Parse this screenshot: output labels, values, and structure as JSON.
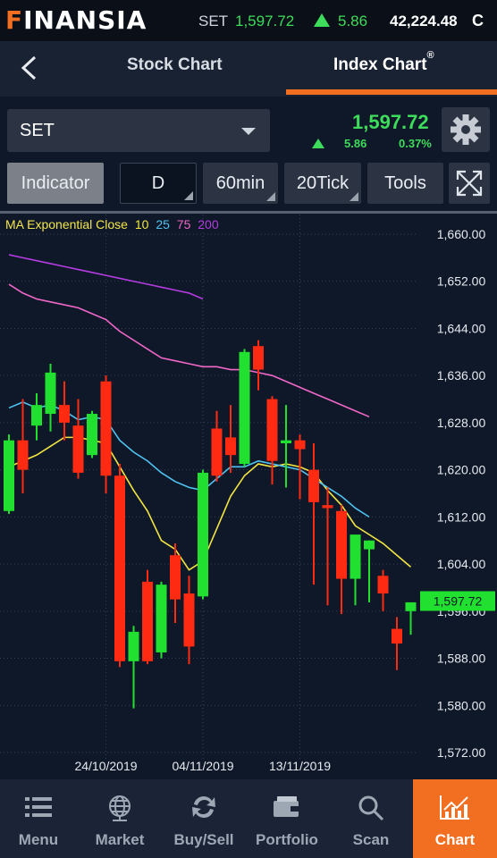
{
  "status": {
    "logo": "FINANSIA",
    "index_name": "SET",
    "index_value": "1,597.72",
    "index_change": "5.86",
    "volume": "42,224.48",
    "market_status": "C",
    "up_color": "#3ddc5a"
  },
  "header": {
    "back_icon": "chevron-left-icon",
    "tabs": [
      {
        "label": "Stock Chart",
        "active": false
      },
      {
        "label": "Index Chart",
        "active": true
      }
    ],
    "registered_mark": "®",
    "accent": "#f26f21"
  },
  "symbol": {
    "selected": "SET",
    "price": "1,597.72",
    "change": "5.86",
    "change_pct": "0.37%",
    "settings_icon": "gear-icon"
  },
  "toolbar": {
    "indicator": "Indicator",
    "period": "D",
    "interval_60": "60min",
    "tick_20": "20Tick",
    "tools": "Tools",
    "fullscreen_icon": "expand-icon"
  },
  "legend": {
    "label": "MA Exponential Close",
    "periods": [
      {
        "period": "10",
        "color": "#f2e542"
      },
      {
        "period": "25",
        "color": "#4fc3f0"
      },
      {
        "period": "75",
        "color": "#f067c8"
      },
      {
        "period": "200",
        "color": "#b43ce0"
      }
    ]
  },
  "chart_data": {
    "type": "candlestick",
    "ylim": [
      1568,
      1664
    ],
    "y_ticks": [
      "1,660.00",
      "1,652.00",
      "1,644.00",
      "1,636.00",
      "1,628.00",
      "1,620.00",
      "1,612.00",
      "1,604.00",
      "1,596.00",
      "1,588.00",
      "1,580.00",
      "1,572.00"
    ],
    "y_tick_values": [
      1660,
      1652,
      1644,
      1636,
      1628,
      1620,
      1612,
      1604,
      1596,
      1588,
      1580,
      1572
    ],
    "x_tick_labels": [
      {
        "label": "24/10/2019",
        "index": 7
      },
      {
        "label": "04/11/2019",
        "index": 14
      },
      {
        "label": "13/11/2019",
        "index": 21
      }
    ],
    "last_price_label": "1,597.72",
    "up_color": "#21e02f",
    "down_color": "#ff2a12",
    "candles": [
      {
        "o": 1613.0,
        "h": 1626.0,
        "l": 1612.5,
        "c": 1625.0
      },
      {
        "o": 1625.0,
        "h": 1632.0,
        "l": 1616.0,
        "c": 1620.0
      },
      {
        "o": 1627.5,
        "h": 1633.0,
        "l": 1625.0,
        "c": 1631.0
      },
      {
        "o": 1629.5,
        "h": 1638.0,
        "l": 1626.5,
        "c": 1636.5
      },
      {
        "o": 1631.0,
        "h": 1635.0,
        "l": 1625.0,
        "c": 1628.0
      },
      {
        "o": 1627.5,
        "h": 1632.0,
        "l": 1618.5,
        "c": 1619.5
      },
      {
        "o": 1622.5,
        "h": 1630.0,
        "l": 1622.0,
        "c": 1629.5
      },
      {
        "o": 1635.0,
        "h": 1636.0,
        "l": 1616.0,
        "c": 1619.0
      },
      {
        "o": 1619.0,
        "h": 1621.0,
        "l": 1586.5,
        "c": 1587.5
      },
      {
        "o": 1587.5,
        "h": 1593.5,
        "l": 1579.5,
        "c": 1592.5
      },
      {
        "o": 1601.0,
        "h": 1603.0,
        "l": 1587.0,
        "c": 1587.5
      },
      {
        "o": 1589.0,
        "h": 1601.0,
        "l": 1588.0,
        "c": 1600.5
      },
      {
        "o": 1605.5,
        "h": 1607.5,
        "l": 1594.0,
        "c": 1598.0
      },
      {
        "o": 1599.0,
        "h": 1602.0,
        "l": 1587.0,
        "c": 1590.0
      },
      {
        "o": 1598.5,
        "h": 1620.0,
        "l": 1598.0,
        "c": 1619.5
      },
      {
        "o": 1627.0,
        "h": 1630.0,
        "l": 1618.0,
        "c": 1619.0
      },
      {
        "o": 1625.5,
        "h": 1631.0,
        "l": 1619.5,
        "c": 1622.5
      },
      {
        "o": 1621.0,
        "h": 1640.5,
        "l": 1620.5,
        "c": 1640.0
      },
      {
        "o": 1641.0,
        "h": 1642.0,
        "l": 1633.5,
        "c": 1637.0
      },
      {
        "o": 1632.0,
        "h": 1632.5,
        "l": 1617.5,
        "c": 1621.5
      },
      {
        "o": 1624.5,
        "h": 1631.0,
        "l": 1617.0,
        "c": 1625.0
      },
      {
        "o": 1625.0,
        "h": 1626.0,
        "l": 1615.0,
        "c": 1623.5
      },
      {
        "o": 1620.0,
        "h": 1624.5,
        "l": 1600.5,
        "c": 1614.5
      },
      {
        "o": 1614.0,
        "h": 1617.0,
        "l": 1597.0,
        "c": 1613.5
      },
      {
        "o": 1613.0,
        "h": 1614.0,
        "l": 1595.5,
        "c": 1601.5
      },
      {
        "o": 1601.5,
        "h": 1609.0,
        "l": 1597.0,
        "c": 1609.0
      },
      {
        "o": 1606.5,
        "h": 1608.0,
        "l": 1597.5,
        "c": 1608.0
      },
      {
        "o": 1602.0,
        "h": 1603.0,
        "l": 1596.0,
        "c": 1599.0
      },
      {
        "o": 1593.0,
        "h": 1595.0,
        "l": 1586.0,
        "c": 1590.5
      },
      {
        "o": 1596.0,
        "h": 1597.5,
        "l": 1592.0,
        "c": 1597.5
      }
    ],
    "ma": [
      {
        "period": 10,
        "color": "#f2e542",
        "values": [
          1620.5,
          1621.5,
          1622.5,
          1624.0,
          1625.5,
          1625.5,
          1625.0,
          1624.5,
          1620.5,
          1616.5,
          1613.0,
          1608.0,
          1606.5,
          1603.0,
          1604.5,
          1610.0,
          1615.5,
          1619.0,
          1621.0,
          1620.5,
          1621.0,
          1620.5,
          1619.5,
          1616.5,
          1614.0,
          1610.5,
          1609.0,
          1607.5,
          1605.5,
          1603.5
        ]
      },
      {
        "period": 25,
        "color": "#4fc3f0",
        "values": [
          1630.5,
          1631.5,
          1630.5,
          1631.0,
          1630.0,
          1628.5,
          1629.0,
          1628.5,
          1625.0,
          1623.0,
          1621.5,
          1619.5,
          1618.0,
          1617.0,
          1616.5,
          1618.5,
          1620.5,
          1620.5,
          1621.5,
          1621.0,
          1620.5,
          1620.0,
          1618.5,
          1617.0,
          1615.5,
          1613.5,
          1612.0
        ]
      },
      {
        "period": 75,
        "color": "#f067c8",
        "values": [
          1651.5,
          1650.0,
          1649.0,
          1648.5,
          1648.0,
          1647.5,
          1646.5,
          1645.5,
          1643.5,
          1642.0,
          1640.5,
          1639.0,
          1638.5,
          1638.0,
          1637.5,
          1637.5,
          1637.0,
          1637.0,
          1636.5,
          1636.0,
          1635.0,
          1634.0,
          1633.0,
          1632.0,
          1631.0,
          1630.0,
          1629.0
        ]
      },
      {
        "period": 200,
        "color": "#b43ce0",
        "values": [
          1656.5,
          1656.0,
          1655.5,
          1655.0,
          1654.5,
          1654.0,
          1653.5,
          1653.0,
          1652.5,
          1652.0,
          1651.5,
          1651.0,
          1650.5,
          1650.0,
          1649.0
        ]
      }
    ]
  },
  "bottom_nav": [
    {
      "label": "Menu",
      "icon": "menu-icon",
      "active": false
    },
    {
      "label": "Market",
      "icon": "globe-icon",
      "active": false
    },
    {
      "label": "Buy/Sell",
      "icon": "swap-icon",
      "active": false
    },
    {
      "label": "Portfolio",
      "icon": "wallet-icon",
      "active": false
    },
    {
      "label": "Scan",
      "icon": "search-icon",
      "active": false
    },
    {
      "label": "Chart",
      "icon": "chart-icon",
      "active": true
    }
  ]
}
